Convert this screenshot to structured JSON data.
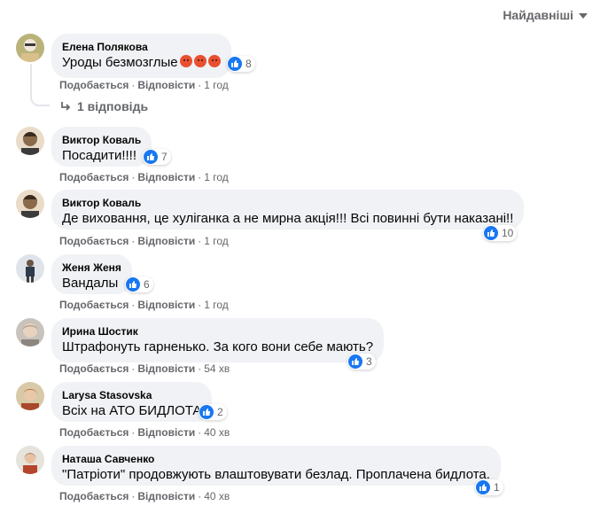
{
  "sort": {
    "label": "Найдавніші"
  },
  "actions": {
    "like": "Подобається",
    "reply": "Відповісти",
    "separator": "·"
  },
  "replies": {
    "label": "1 відповідь"
  },
  "comments": [
    {
      "author": "Елена Полякова",
      "text": "Уроды безмозглые",
      "emoji_count": 3,
      "likes": "8",
      "time": "1 год"
    },
    {
      "author": "Виктор Коваль",
      "text": "Посадити!!!!",
      "likes": "7",
      "time": "1 год"
    },
    {
      "author": "Виктор Коваль",
      "text": "Де виховання, це хуліганка а не мирна акція!!! Всі повинні бути наказані!!",
      "likes": "10",
      "time": "1 год"
    },
    {
      "author": "Женя Женя",
      "text": "Вандалы",
      "likes": "6",
      "time": "1 год"
    },
    {
      "author": "Ирина Шостик",
      "text": "Штрафонуть гарненько. За кого вони себе мають?",
      "likes": "3",
      "time": "54 хв"
    },
    {
      "author": "Larysa Stasovska",
      "text": "Всіх на АТО БИДЛОТА",
      "likes": "2",
      "time": "40 хв"
    },
    {
      "author": "Наташа Савченко",
      "text": "\"Патріоти\" продовжують влаштовувати безлад. Проплачена бидлота.",
      "likes": "1",
      "time": "40 хв"
    }
  ],
  "colors": {
    "bubble": "#f0f2f5",
    "secondary_text": "#65676b",
    "like_blue": "#1877f2",
    "emoji": "#e8502f"
  }
}
